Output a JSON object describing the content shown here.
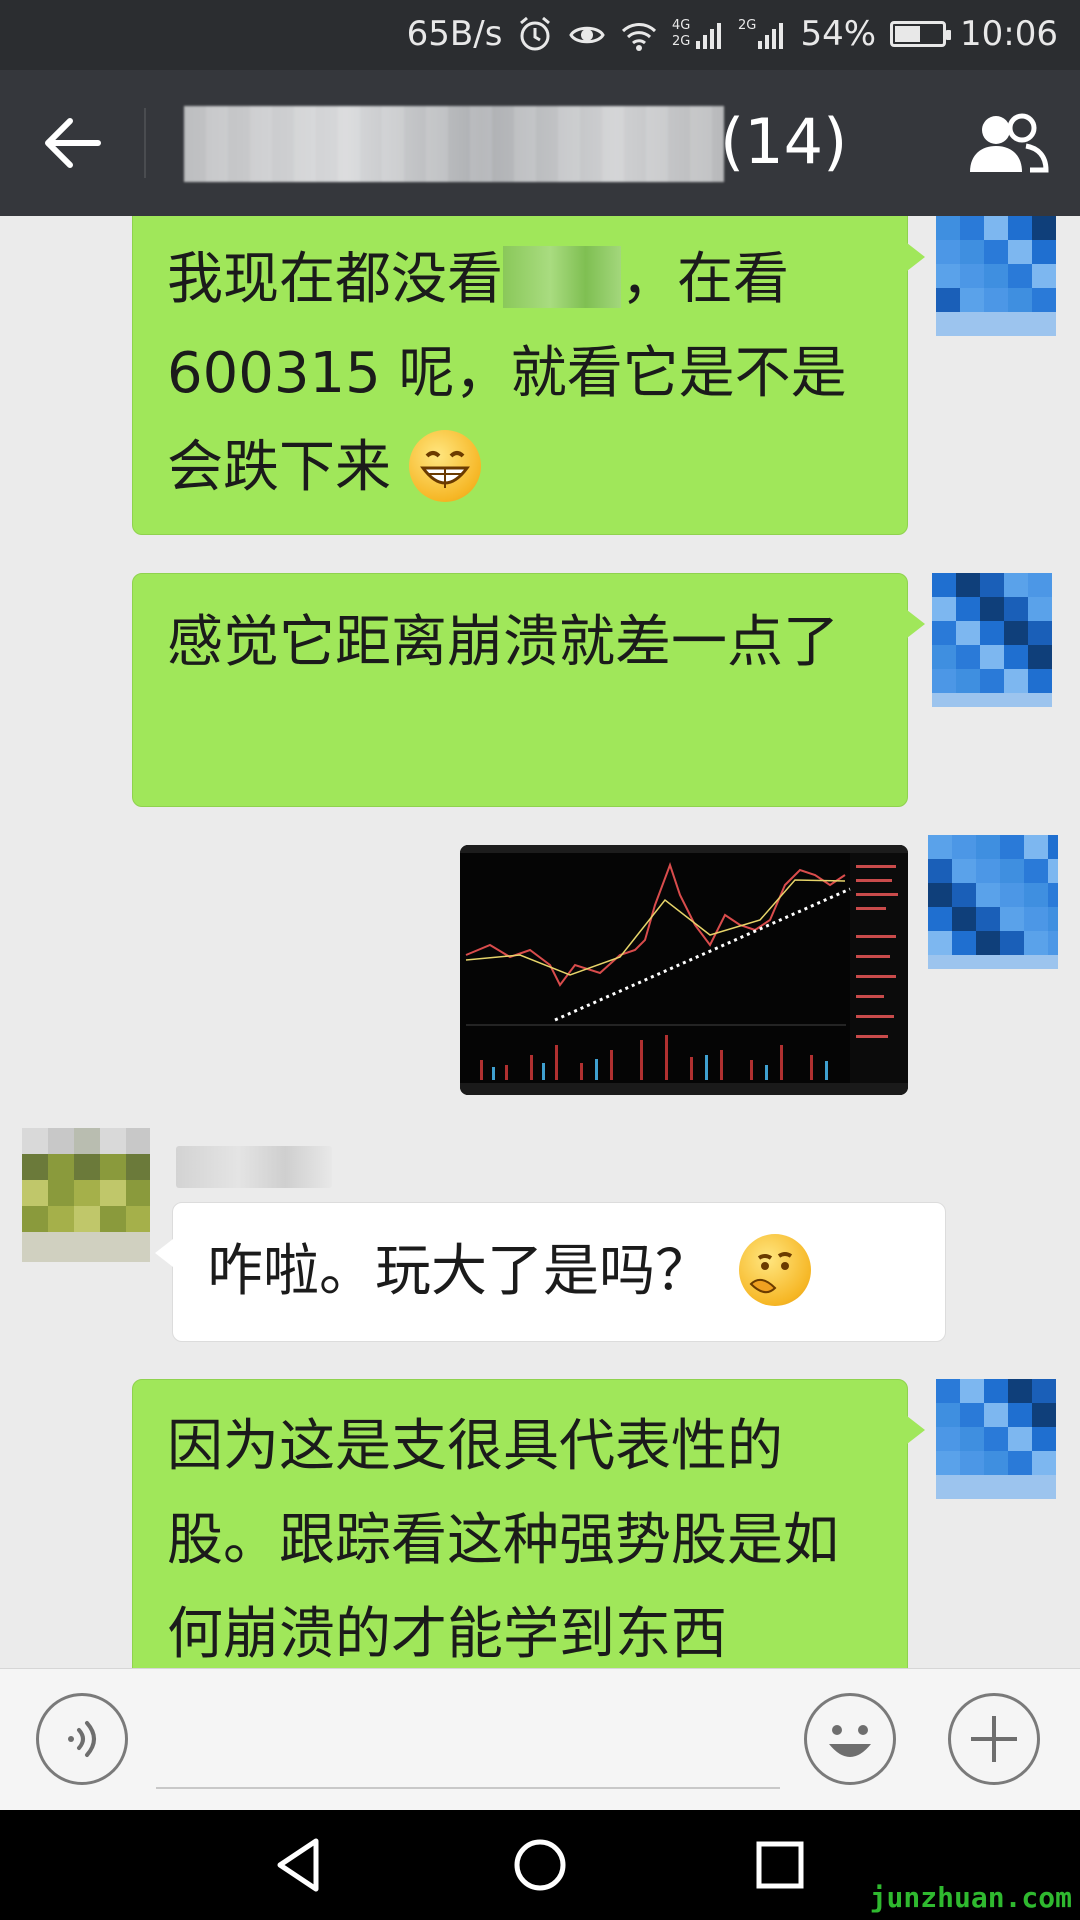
{
  "status_bar": {
    "net_speed": "65B/s",
    "battery": "54%",
    "battery_level": 0.54,
    "time": "10:06",
    "signal_1_label": "4G 2G",
    "signal_2_label": "2G"
  },
  "title_bar": {
    "member_count": "(14)"
  },
  "messages": [
    {
      "side": "right",
      "type": "text",
      "segments": [
        "我现在都没看",
        "，在看600315 呢，就看它是不是会跌下来"
      ],
      "emoji": "grinning-face"
    },
    {
      "side": "right",
      "type": "text",
      "text": "感觉它距离崩溃就差一点了"
    },
    {
      "side": "right",
      "type": "image",
      "image": "stock-chart-screenshot"
    },
    {
      "side": "left",
      "type": "text",
      "text": "咋啦。玩大了是吗？",
      "emoji": "thinking-face"
    },
    {
      "side": "right",
      "type": "text",
      "text": "因为这是支很具代表性的股。跟踪看这种强势股是如何崩溃的才能学到东西"
    }
  ],
  "input_bar": {
    "voice_icon": "voice-icon",
    "emoji_icon": "emoji-icon",
    "plus_icon": "plus-icon"
  },
  "watermark": "junzhuan.com",
  "colors": {
    "self_bubble": "#a0e75a",
    "other_bubble": "#ffffff",
    "title_bar": "#35373c",
    "chat_bg": "#ebebeb"
  }
}
